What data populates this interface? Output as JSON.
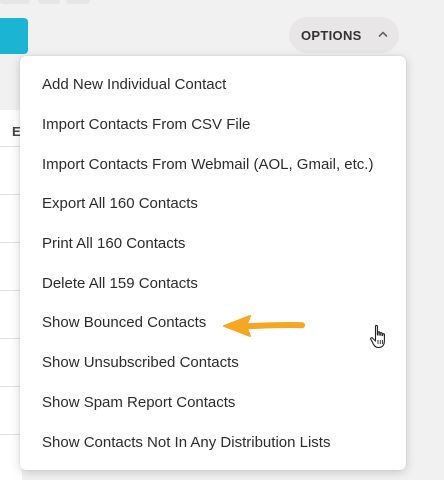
{
  "options_button": {
    "label": "OPTIONS",
    "icon": "chevron-up-icon"
  },
  "background": {
    "table_header_fragment": "E"
  },
  "menu": {
    "items": [
      {
        "label": "Add New Individual Contact"
      },
      {
        "label": "Import Contacts From CSV File"
      },
      {
        "label": "Import Contacts From Webmail (AOL, Gmail, etc.)"
      },
      {
        "label": "Export All 160 Contacts"
      },
      {
        "label": "Print All 160 Contacts"
      },
      {
        "label": "Delete All 159 Contacts"
      },
      {
        "label": "Show Bounced Contacts"
      },
      {
        "label": "Show Unsubscribed Contacts"
      },
      {
        "label": "Show Spam Report Contacts"
      },
      {
        "label": "Show Contacts Not In Any Distribution Lists"
      }
    ]
  },
  "annotation": {
    "icon": "arrow-left-icon",
    "color": "#f5a623"
  },
  "cursor": {
    "icon": "hand-pointer-icon"
  },
  "colors": {
    "accent_button": "#1bb5d3",
    "options_bg": "#e8e6e6"
  }
}
